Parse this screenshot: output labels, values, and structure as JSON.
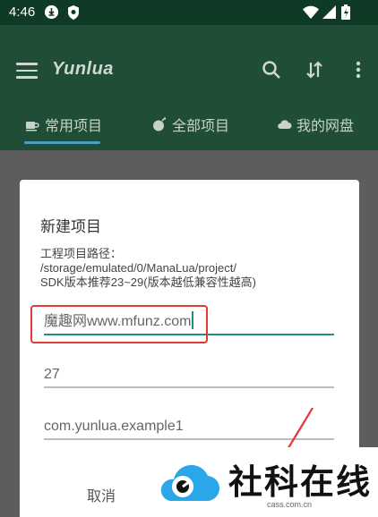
{
  "status_bar": {
    "time": "4:46"
  },
  "app": {
    "title": "Yunlua"
  },
  "tabs": [
    {
      "label": "常用项目",
      "icon": "coffee-icon"
    },
    {
      "label": "全部项目",
      "icon": "bomb-icon"
    },
    {
      "label": "我的网盘",
      "icon": "cloud-icon"
    }
  ],
  "dialog": {
    "title": "新建项目",
    "description": "工程项目路径：\n/storage/emulated/0/ManaLua/project/\nSDK版本推荐23~29(版本越低兼容性越高)",
    "app_name_value": "魔趣网www.mfunz.com",
    "sdk_value": "27",
    "package_value": "com.yunlua.example1",
    "cancel_label": "取消"
  },
  "watermark": {
    "text": "社科在线",
    "sub": "cass.com.cn"
  },
  "colors": {
    "appbar": "#1f4d36",
    "status": "#0f3a26",
    "accent": "#1e8f7a",
    "highlight": "#e53935"
  }
}
